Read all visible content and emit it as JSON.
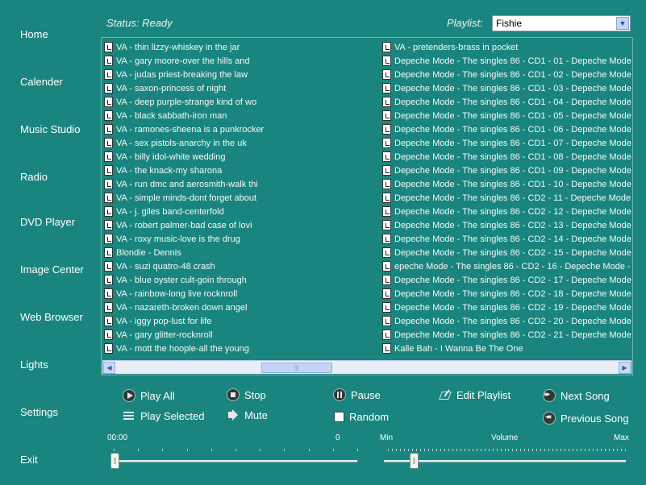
{
  "nav": [
    "Home",
    "Calender",
    "Music Studio",
    "Radio",
    "DVD Player",
    "Image Center",
    "Web Browser",
    "Lights",
    "Settings",
    "Exit"
  ],
  "status": "Status: Ready",
  "playlist": {
    "label": "Playlist:",
    "selected": "Fishie"
  },
  "left_tracks": [
    "VA - thin lizzy-whiskey in the jar",
    "VA - gary moore-over the hills and",
    "VA - judas priest-breaking the law",
    "VA - saxon-princess of night",
    "VA - deep purple-strange kind of wo",
    "VA - black sabbath-iron man",
    "VA - ramones-sheena is a punkrocker",
    "VA - sex pistols-anarchy in the uk",
    "VA - billy idol-white wedding",
    "VA - the knack-my sharona",
    "VA - run dmc and aerosmith-walk thi",
    "VA - simple minds-dont forget about",
    "VA - j. giles band-centerfold",
    "VA - robert palmer-bad case of lovi",
    "VA - roxy music-love is the drug",
    "Blondie - Dennis",
    "VA - suzi quatro-48 crash",
    "VA - blue oyster cult-goin through",
    "VA - rainbow-long live rocknroll",
    "VA - nazareth-broken down angel",
    "VA - iggy pop-lust for life",
    "VA - gary glitter-rocknroll",
    "VA - mott the hoople-all the young"
  ],
  "right_tracks": [
    "VA - pretenders-brass in pocket",
    "Depeche Mode - The singles 86 - CD1 - 01 - Depeche Mode -",
    "Depeche Mode - The singles 86 - CD1 - 02 - Depeche Mode -",
    "Depeche Mode - The singles 86 - CD1 - 03 - Depeche Mode -",
    "Depeche Mode - The singles 86 - CD1 - 04 - Depeche Mode -",
    "Depeche Mode - The singles 86 - CD1 - 05 - Depeche Mode -",
    "Depeche Mode - The singles 86 - CD1 - 06 - Depeche Mode -",
    "Depeche Mode - The singles 86 - CD1 - 07 - Depeche Mode -",
    "Depeche Mode - The singles 86 - CD1 - 08 - Depeche Mode -",
    "Depeche Mode - The singles 86 - CD1 - 09 - Depeche Mode -",
    "Depeche Mode - The singles 86 - CD1 - 10 - Depeche Mode -",
    "Depeche Mode - The singles 86 - CD2 - 11 - Depeche Mode -",
    "Depeche Mode - The singles 86 - CD2 - 12 - Depeche Mode -",
    "Depeche Mode - The singles 86 - CD2 - 13 - Depeche Mode -",
    "Depeche Mode - The singles 86 - CD2 - 14 - Depeche Mode -",
    "Depeche Mode - The singles 86 - CD2 - 15 - Depeche Mode -",
    "epeche Mode - The singles 86 - CD2 - 16 - Depeche Mode - It",
    "Depeche Mode - The singles 86 - CD2 - 17 - Depeche Mode -",
    "Depeche Mode - The singles 86 - CD2 - 18 - Depeche Mode -",
    "Depeche Mode - The singles 86 - CD2 - 19 - Depeche Mode -",
    "Depeche Mode - The singles 86 - CD2 - 20 - Depeche Mode -",
    "Depeche Mode - The singles 86 - CD2 - 21 - Depeche Mode -",
    "Kalle Bah - I Wanna Be The One"
  ],
  "controls": {
    "play_all": "Play All",
    "play_selected": "Play Selected",
    "stop": "Stop",
    "mute": "Mute",
    "pause": "Pause",
    "random": "Random",
    "edit_playlist": "Edit Playlist",
    "next_song": "Next Song",
    "previous_song": "Previous Song"
  },
  "position": {
    "elapsed": "00:00",
    "total": "0",
    "level": 0.0
  },
  "volume": {
    "label": "Volume",
    "min": "Min",
    "max": "Max",
    "level": 0.11
  },
  "colors": {
    "background": "#1a857e",
    "text": "#ffffff"
  }
}
